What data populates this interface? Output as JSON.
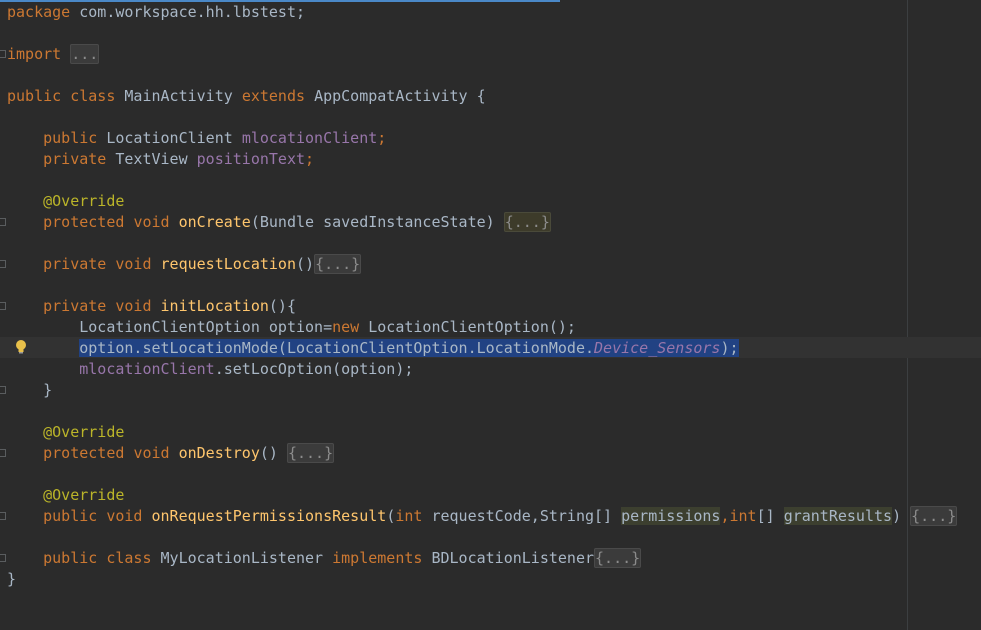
{
  "editor": {
    "package_kw": "package",
    "package_name": " com.workspace.hh.lbstest;",
    "import_kw": "import",
    "import_fold": "...",
    "class_decl": {
      "public": "public",
      "class": "class",
      "name": "MainActivity",
      "extends": "extends",
      "parent": "AppCompatActivity",
      "brace": "{"
    },
    "field1": {
      "mod": "public",
      "type": " LocationClient ",
      "name": "mlocationClient",
      "end": ";"
    },
    "field2": {
      "mod": "private",
      "type": " TextView ",
      "name": "positionText",
      "end": ";"
    },
    "override": "@Override",
    "oncreate": {
      "mod": "protected",
      "ret": "void",
      "name": "onCreate",
      "params": "(Bundle savedInstanceState) ",
      "fold": "{...}"
    },
    "reqloc": {
      "mod": "private",
      "ret": "void",
      "name": "requestLocation",
      "params": "()",
      "fold": "{...}"
    },
    "initloc": {
      "mod": "private",
      "ret": "void",
      "name": "initLocation",
      "params": "(){"
    },
    "line_option": {
      "type": "LocationClientOption option=",
      "new": "new",
      "rest": " LocationClientOption();"
    },
    "line_setmode": {
      "pre": "option.setLocationMode(LocationClientOption.LocationMode.",
      "const": "Device_Sensors",
      "end": ");"
    },
    "line_setopt": {
      "field": "mlocationClient",
      "rest": ".setLocOption(option);"
    },
    "close_brace": "}",
    "ondestroy": {
      "mod": "protected",
      "ret": "void",
      "name": "onDestroy",
      "params": "() ",
      "fold": "{...}"
    },
    "onreq": {
      "mod": "public",
      "ret": "void",
      "name": "onRequestPermissionsResult",
      "p1": "(",
      "int": "int",
      "p2": " requestCode,String[] ",
      "perm": "permissions",
      "comma": ",",
      "int2": "int",
      "p3": "[] ",
      "grant": "grantResults",
      "p4": ") ",
      "fold": "{...}"
    },
    "listener": {
      "mod": "public",
      "class": "class",
      "name": " MyLocationListener ",
      "impl": "implements",
      "iface": " BDLocationListener",
      "fold": "{...}"
    },
    "final_brace": "}"
  },
  "colors": {
    "background": "#2b2b2b",
    "keyword": "#cc7832",
    "field": "#9876aa",
    "method": "#ffc66d",
    "annotation": "#bbb529",
    "text": "#a9b7c6",
    "selection": "#214283"
  }
}
